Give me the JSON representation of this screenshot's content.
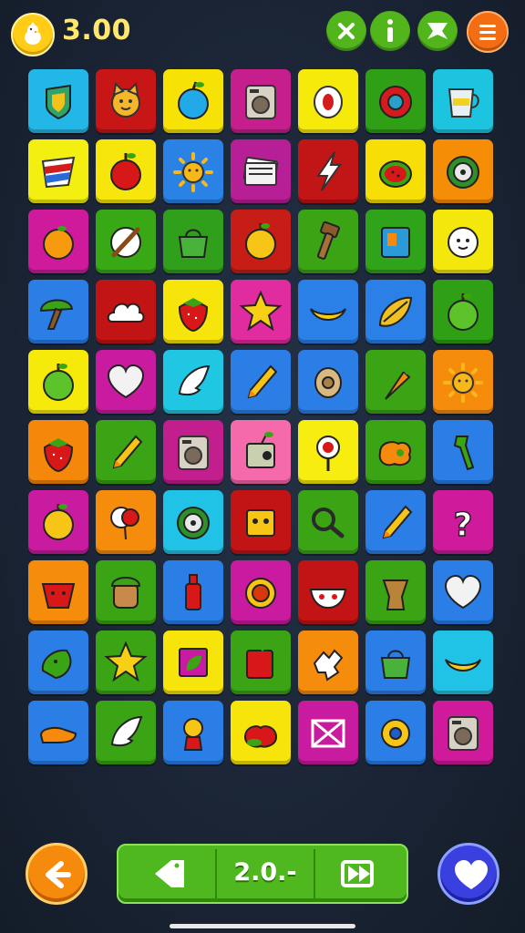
{
  "hud": {
    "score": "3.00",
    "icons": {
      "coin": "chick-coin-icon",
      "close": "close-icon",
      "info": "info-icon",
      "bookmark": "bookmark-icon",
      "menu": "menu-icon"
    }
  },
  "board": {
    "rows": 10,
    "cols": 7,
    "tiles": [
      [
        {
          "bg": "#22b7e6",
          "icon": "shield"
        },
        {
          "bg": "#c81515",
          "icon": "cat-face"
        },
        {
          "bg": "#f7e205",
          "icon": "blue-apple"
        },
        {
          "bg": "#c71e8e",
          "icon": "washing-machine"
        },
        {
          "bg": "#f6ea0b",
          "icon": "ring"
        },
        {
          "bg": "#2f9f16",
          "icon": "donut"
        },
        {
          "bg": "#1cc4df",
          "icon": "cup"
        }
      ],
      [
        {
          "bg": "#f3ef10",
          "icon": "flag"
        },
        {
          "bg": "#f6e60c",
          "icon": "apple"
        },
        {
          "bg": "#2a82e4",
          "icon": "sun"
        },
        {
          "bg": "#b61f95",
          "icon": "papers"
        },
        {
          "bg": "#c21515",
          "icon": "lightning"
        },
        {
          "bg": "#f7df05",
          "icon": "melon"
        },
        {
          "bg": "#f68d07",
          "icon": "wheel"
        }
      ],
      [
        {
          "bg": "#cf1a9c",
          "icon": "orange"
        },
        {
          "bg": "#38a815",
          "icon": "compass"
        },
        {
          "bg": "#2f9f1c",
          "icon": "bag"
        },
        {
          "bg": "#c61e16",
          "icon": "yellow-apple"
        },
        {
          "bg": "#3aa415",
          "icon": "hammer"
        },
        {
          "bg": "#2fa31a",
          "icon": "box"
        },
        {
          "bg": "#f4e70c",
          "icon": "cloud-face"
        }
      ],
      [
        {
          "bg": "#2a7ee6",
          "icon": "tree"
        },
        {
          "bg": "#c21414",
          "icon": "cloud"
        },
        {
          "bg": "#f7e40a",
          "icon": "strawberry"
        },
        {
          "bg": "#e02c9e",
          "icon": "star"
        },
        {
          "bg": "#2a80e6",
          "icon": "banana"
        },
        {
          "bg": "#2a80e6",
          "icon": "leaf"
        },
        {
          "bg": "#2f9f16",
          "icon": "green-apple"
        }
      ],
      [
        {
          "bg": "#f6ea0a",
          "icon": "green-apple"
        },
        {
          "bg": "#c81b9f",
          "icon": "heart"
        },
        {
          "bg": "#20c7e3",
          "icon": "feather"
        },
        {
          "bg": "#2a7ee6",
          "icon": "pencil"
        },
        {
          "bg": "#2a7ee6",
          "icon": "clock"
        },
        {
          "bg": "#3aa415",
          "icon": "carrot"
        },
        {
          "bg": "#f68c0c",
          "icon": "sun"
        }
      ],
      [
        {
          "bg": "#f5880a",
          "icon": "strawberry"
        },
        {
          "bg": "#3aa415",
          "icon": "pencil"
        },
        {
          "bg": "#c21e8d",
          "icon": "washing-machine"
        },
        {
          "bg": "#f46aab",
          "icon": "radio"
        },
        {
          "bg": "#f7ee10",
          "icon": "pin"
        },
        {
          "bg": "#3aa415",
          "icon": "blob"
        },
        {
          "bg": "#2a7ee6",
          "icon": "tool"
        }
      ],
      [
        {
          "bg": "#c81b9f",
          "icon": "yellow-apple"
        },
        {
          "bg": "#f68c0c",
          "icon": "balloons"
        },
        {
          "bg": "#20c2e6",
          "icon": "wheel"
        },
        {
          "bg": "#c21414",
          "icon": "robot"
        },
        {
          "bg": "#3aa415",
          "icon": "magnifier"
        },
        {
          "bg": "#2a7ee6",
          "icon": "pencil"
        },
        {
          "bg": "#cf1a9c",
          "icon": "question"
        }
      ],
      [
        {
          "bg": "#f68c0c",
          "icon": "monster"
        },
        {
          "bg": "#3aa415",
          "icon": "acorn"
        },
        {
          "bg": "#2a7ee6",
          "icon": "bottle"
        },
        {
          "bg": "#c81b9f",
          "icon": "button"
        },
        {
          "bg": "#c21414",
          "icon": "bowl"
        },
        {
          "bg": "#3aa415",
          "icon": "vase"
        },
        {
          "bg": "#2a7ee6",
          "icon": "heart"
        }
      ],
      [
        {
          "bg": "#2a7ee6",
          "icon": "leaf-frog"
        },
        {
          "bg": "#3aa415",
          "icon": "star"
        },
        {
          "bg": "#f7e40a",
          "icon": "frame"
        },
        {
          "bg": "#3aa415",
          "icon": "book"
        },
        {
          "bg": "#f68c0c",
          "icon": "puzzle"
        },
        {
          "bg": "#2a7ee6",
          "icon": "bag"
        },
        {
          "bg": "#20c2e6",
          "icon": "banana"
        }
      ],
      [
        {
          "bg": "#2a7ee6",
          "icon": "shoe"
        },
        {
          "bg": "#3aa415",
          "icon": "feather"
        },
        {
          "bg": "#2a7ee6",
          "icon": "doll"
        },
        {
          "bg": "#f7e40a",
          "icon": "berry"
        },
        {
          "bg": "#c81b9f",
          "icon": "bow"
        },
        {
          "bg": "#2a7ee6",
          "icon": "flower"
        },
        {
          "bg": "#cf1a9c",
          "icon": "washing-machine"
        }
      ]
    ]
  },
  "controls": {
    "level": "2.0.-",
    "icons": {
      "back": "back-arrow-icon",
      "prev": "prev-tag-icon",
      "next": "skip-forward-icon",
      "favorite": "heart-icon"
    }
  }
}
